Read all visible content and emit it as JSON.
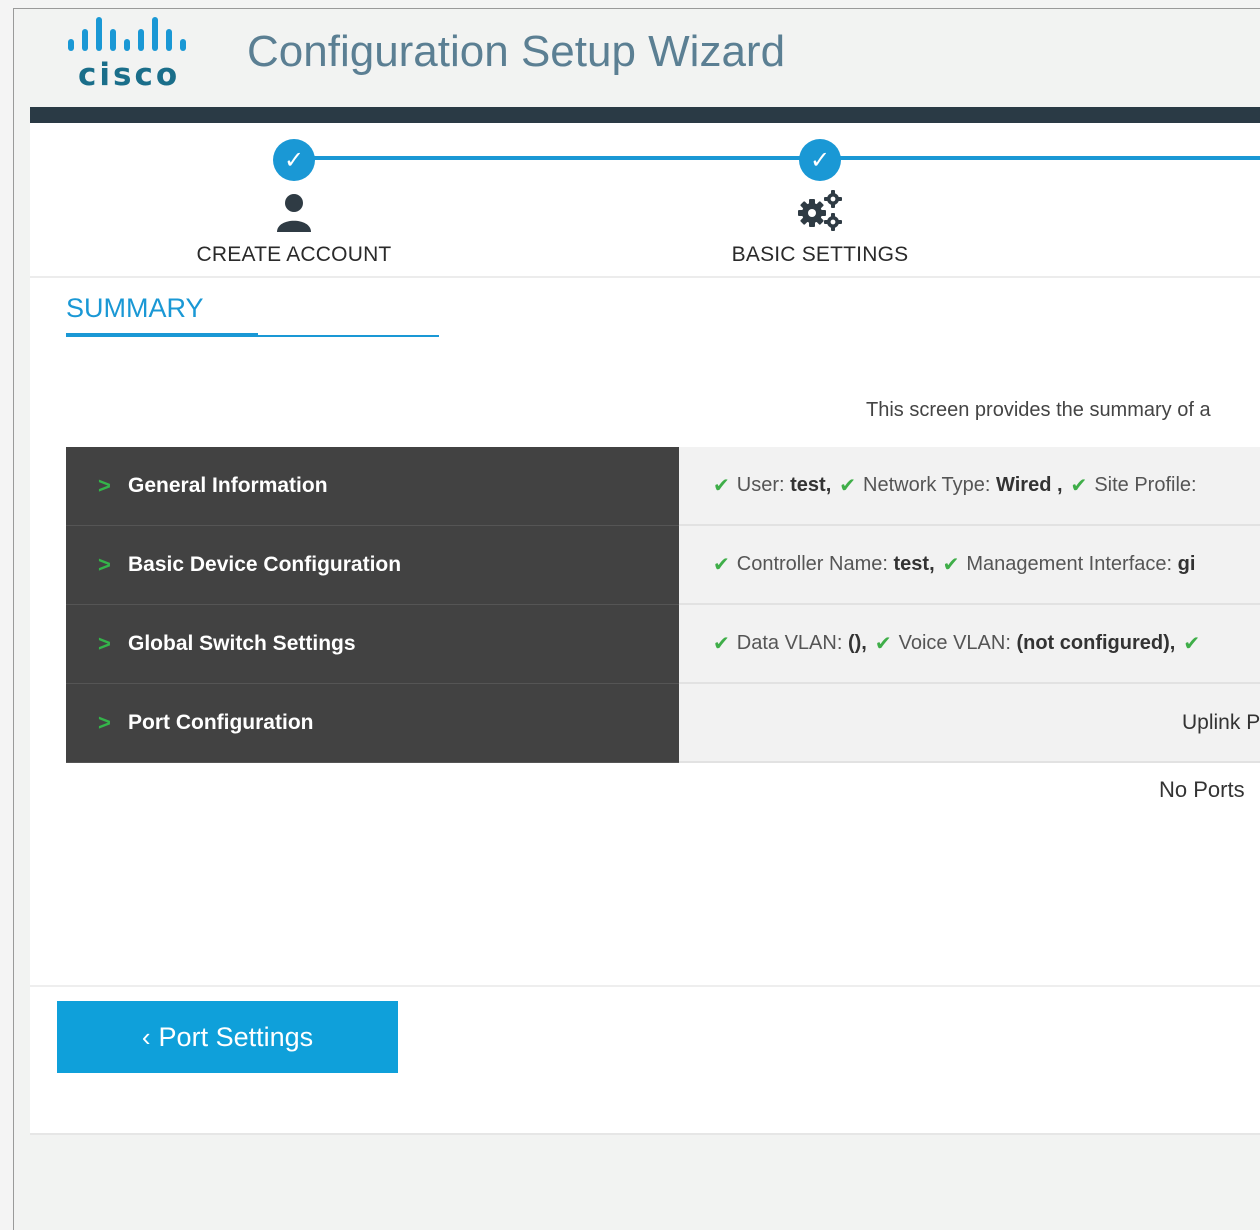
{
  "header": {
    "logo_text": "cisco",
    "title": "Configuration Setup Wizard"
  },
  "steps": [
    {
      "label": "CREATE ACCOUNT",
      "status": "completed",
      "icon": "user-icon"
    },
    {
      "label": "BASIC SETTINGS",
      "status": "completed",
      "icon": "gears-icon"
    }
  ],
  "tab": {
    "label": "SUMMARY"
  },
  "intro": "This screen provides the summary of a",
  "summary_rows": [
    {
      "label": "General Information",
      "items": [
        {
          "key": "User:",
          "value": "test,"
        },
        {
          "key": "Network Type:",
          "value": "Wired ,"
        },
        {
          "key": "Site Profile:",
          "value": ""
        }
      ]
    },
    {
      "label": "Basic Device Configuration",
      "items": [
        {
          "key": "Controller Name:",
          "value": "test,"
        },
        {
          "key": "Management Interface:",
          "value": "gi"
        }
      ]
    },
    {
      "label": "Global Switch Settings",
      "items": [
        {
          "key": "Data VLAN:",
          "value": "(),"
        },
        {
          "key": "Voice VLAN:",
          "value": "(not configured),"
        },
        {
          "key": "",
          "value": ""
        }
      ]
    },
    {
      "label": "Port Configuration",
      "text": "Uplink P"
    }
  ],
  "no_ports": "No Ports",
  "back_button": {
    "label": "Port Settings"
  },
  "colors": {
    "accent": "#1a98d5",
    "check": "#3fae49",
    "dark_row": "#424242",
    "brand": "#1a6e8a"
  }
}
